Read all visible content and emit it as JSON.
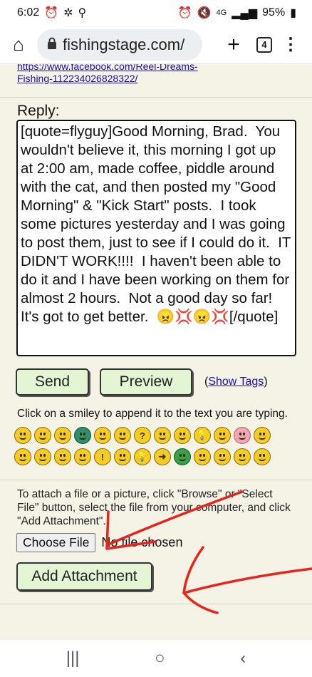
{
  "status_bar": {
    "time": "6:02",
    "network": "4G LTE",
    "battery": "95%"
  },
  "browser": {
    "url": "fishingstage.com/",
    "tab_count": "4"
  },
  "post": {
    "link_line1": "https://www.facebook.com/Reel-Dreams-",
    "link_line2": "Fishing-112234026828322/"
  },
  "reply": {
    "label": "Reply:",
    "text": "[quote=flyguy]Good Morning, Brad.  You wouldn't believe it, this morning I got up at 2:00 am, made coffee, piddle around with the cat, and then posted my \"Good Morning\" & \"Kick Start\" posts.  I took some pictures yesterday and I was going to post them, just to see if I could do it.  IT DIDN'T WORK!!!!  I haven't been able to do it and I have been working on them for almost 2 hours.  Not a good day so far!  It's got to get better.  😠💢😠💢[/quote]"
  },
  "buttons": {
    "send": "Send",
    "preview": "Preview",
    "show_tags_prefix": "(",
    "show_tags": "Show Tags",
    "show_tags_suffix": ")"
  },
  "smileys": {
    "hint": "Click on a smiley to append it to the text you are typing.",
    "items": [
      "smile-icon",
      "grin-icon",
      "sad-icon",
      "teeth-icon",
      "shocked-icon",
      "confused-icon",
      "question-icon",
      "cool-icon",
      "laugh-icon",
      "idea-icon",
      "tongue-icon",
      "blush-icon",
      "frown-icon",
      "mad-icon",
      "evil-icon",
      "rolleyes-icon",
      "wink-icon",
      "exclaim-icon",
      "smirk-icon",
      "idea-bulb-icon",
      "arrow-icon",
      "green-face-icon",
      "twisted-icon",
      "thumbs-up-icon",
      "confused-sign-icon",
      "neutral-icon"
    ]
  },
  "attachment": {
    "instructions": "To attach a file or a picture, click \"Browse\" or \"Select File\" button, select the file from your computer, and click \"Add Attachment\".",
    "choose_file": "Choose File",
    "no_file": "No file chosen",
    "add_attachment": "Add Attachment"
  },
  "colors": {
    "page_bg": "#f5f3e6",
    "button_bg": "#e3f5d3",
    "link": "#1a0dab",
    "annotation": "#e8231c"
  }
}
